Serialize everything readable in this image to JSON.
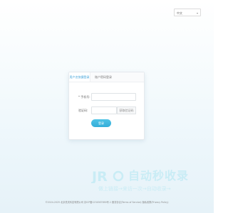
{
  "language": {
    "selected": "中文",
    "arrow_icon": "chevron-down-icon"
  },
  "login": {
    "tabs": [
      {
        "label": "用户名快捷登录",
        "active": true
      },
      {
        "label": "账户密码登录",
        "active": false
      }
    ],
    "phone_label": "* 手机号:",
    "phone_value": "",
    "code_label": "验证码:",
    "code_value": "",
    "sms_button": "获取验证码",
    "submit_label": "登录"
  },
  "watermark": {
    "logo_text": "JR",
    "title": "自动秒收录",
    "subtitle": "做上链接→来访一次→自动收录→"
  },
  "footer": {
    "text": "©2024-2025 北京重庆科技有限公司 京ICP备1234567890号-1 服务协议(Terms of Service) 隐私政策(Privacy Policy)"
  },
  "colors": {
    "accent": "#3aa0d8",
    "button": "#34aed9",
    "watermark": "#c9ecf5"
  }
}
